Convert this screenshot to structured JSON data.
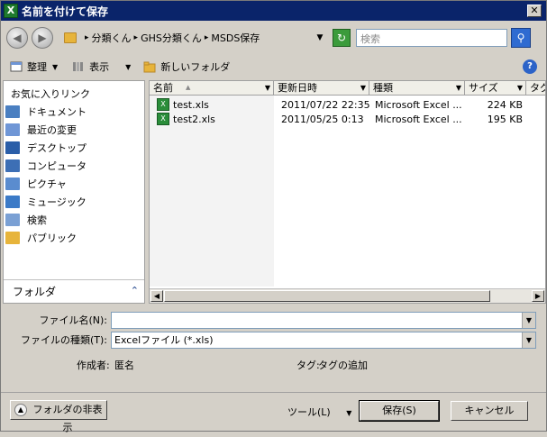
{
  "window": {
    "title": "名前を付けて保存",
    "icon": "excel-icon",
    "close": "✕"
  },
  "address": {
    "crumbs": [
      "分類くん",
      "GHS分類くん",
      "MSDS保存"
    ],
    "search_placeholder": "検索"
  },
  "toolbar": {
    "organize": "整理",
    "view": "表示",
    "new_folder": "新しいフォルダ",
    "help": "?"
  },
  "nav": {
    "favorites_title": "お気に入りリンク",
    "items": [
      {
        "label": "ドキュメント",
        "icon": "documents-icon",
        "color": "#4a7fc1"
      },
      {
        "label": "最近の変更",
        "icon": "recent-icon",
        "color": "#6f96d6"
      },
      {
        "label": "デスクトップ",
        "icon": "desktop-icon",
        "color": "#2a5ea8"
      },
      {
        "label": "コンピュータ",
        "icon": "computer-icon",
        "color": "#3d6fb5"
      },
      {
        "label": "ピクチャ",
        "icon": "pictures-icon",
        "color": "#5a8ccf"
      },
      {
        "label": "ミュージック",
        "icon": "music-icon",
        "color": "#3b7ac7"
      },
      {
        "label": "検索",
        "icon": "search-icon",
        "color": "#7aa0d4"
      },
      {
        "label": "パブリック",
        "icon": "public-folder-icon",
        "color": "#e7b43b"
      }
    ],
    "folders_label": "フォルダ"
  },
  "columns": [
    {
      "label": "名前"
    },
    {
      "label": "更新日時"
    },
    {
      "label": "種類"
    },
    {
      "label": "サイズ"
    },
    {
      "label": "タグ"
    }
  ],
  "files": [
    {
      "name": "test.xls",
      "modified": "2011/07/22 22:35",
      "type": "Microsoft Excel ...",
      "size": "224 KB"
    },
    {
      "name": "test2.xls",
      "modified": "2011/05/25 0:13",
      "type": "Microsoft Excel ...",
      "size": "195 KB"
    }
  ],
  "form": {
    "filename_label": "ファイル名(N):",
    "filename_value": "",
    "filetype_label": "ファイルの種類(T):",
    "filetype_value": "Excelファイル (*.xls)",
    "author_label": "作成者:",
    "author_value": "匿名",
    "tags_label": "タグ:",
    "tags_value": "タグの追加"
  },
  "footer": {
    "hide_folders": "フォルダの非表示",
    "tools": "ツール(L)",
    "save": "保存(S)",
    "cancel": "キャンセル"
  }
}
